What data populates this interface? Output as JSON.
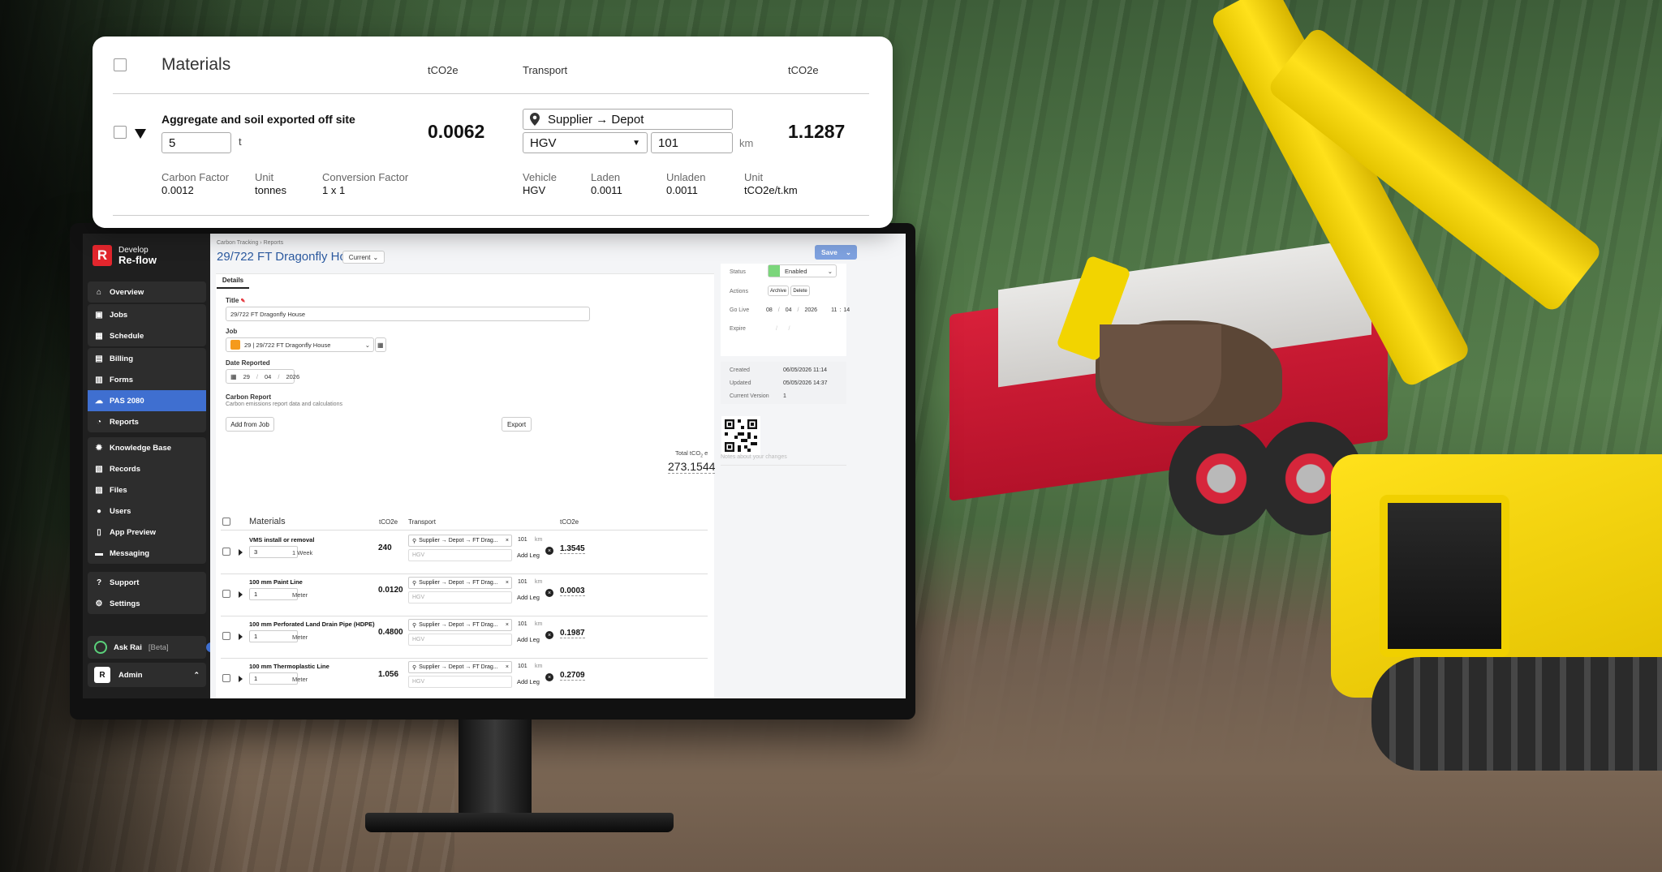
{
  "colors": {
    "brand": "#e3262d",
    "accent": "#2c5aa0",
    "active_nav": "#3f6fd0",
    "status": "#7bd67b"
  },
  "popup": {
    "header": {
      "materials": "Materials",
      "tco2e": "tCO2e",
      "transport": "Transport",
      "tco2e_2": "tCO2e"
    },
    "item": {
      "name": "Aggregate and soil exported off site",
      "qty": "5",
      "qty_unit": "t",
      "tco2e": "0.0062",
      "route": "Supplier → Depot",
      "vehicle_select": "HGV",
      "distance": "101",
      "distance_unit": "km",
      "transport_tco2e": "1.1287",
      "carbon_factor_label": "Carbon Factor",
      "carbon_factor": "0.0012",
      "unit_label": "Unit",
      "unit": "tonnes",
      "conversion_label": "Conversion Factor",
      "conversion": "1 x 1",
      "vehicle_label": "Vehicle",
      "vehicle": "HGV",
      "laden_label": "Laden",
      "laden": "0.0011",
      "unladen_label": "Unladen",
      "unladen": "0.0011",
      "tunit_label": "Unit",
      "tunit": "tCO2e/t.km"
    },
    "icons": {
      "route": "map-pin-icon",
      "expand": "caret-down-icon"
    }
  },
  "app": {
    "logo": {
      "mark": "R",
      "line1": "Develop",
      "line2": "Re-flow"
    },
    "nav": {
      "group1": [
        {
          "label": "Overview",
          "icon": "home-icon"
        }
      ],
      "group2": [
        {
          "label": "Jobs",
          "icon": "briefcase-icon"
        },
        {
          "label": "Schedule",
          "icon": "calendar-icon"
        }
      ],
      "group3": [
        {
          "label": "Billing",
          "icon": "billing-icon"
        },
        {
          "label": "Forms",
          "icon": "forms-icon"
        },
        {
          "label": "PAS 2080",
          "icon": "cloud-icon"
        },
        {
          "label": "Reports",
          "icon": "chart-icon"
        }
      ],
      "group4": [
        {
          "label": "Knowledge Base",
          "icon": "bulb-icon"
        },
        {
          "label": "Records",
          "icon": "records-icon"
        },
        {
          "label": "Files",
          "icon": "files-icon"
        },
        {
          "label": "Users",
          "icon": "users-icon"
        },
        {
          "label": "App Preview",
          "icon": "phone-icon"
        },
        {
          "label": "Messaging",
          "icon": "message-icon"
        }
      ],
      "group5": [
        {
          "label": "Support",
          "icon": "help-icon"
        },
        {
          "label": "Settings",
          "icon": "gear-icon"
        }
      ]
    },
    "ask_rai": {
      "label": "Ask Rai",
      "beta": "[Beta]"
    },
    "admin": {
      "initial": "R",
      "label": "Admin"
    },
    "breadcrumb": "Carbon Tracking  ›  Reports",
    "page_title": "29/722 FT Dragonfly House",
    "version": "Current",
    "save": "Save",
    "tab": "Details",
    "form": {
      "title_label": "Title",
      "title_value": "29/722 FT Dragonfly House",
      "job_label": "Job",
      "job_value": "29 | 29/722 FT Dragonfly House",
      "date_label": "Date Reported",
      "date_d": "29",
      "date_m": "04",
      "date_y": "2026",
      "report_label": "Carbon Report",
      "report_sub": "Carbon emissions report data and calculations",
      "add_from_job": "Add from Job",
      "export": "Export",
      "total_label": "Total tCO",
      "total_sub": "2",
      "total_suffix": "e",
      "total_value": "273.1544"
    },
    "table": {
      "headers": {
        "materials": "Materials",
        "tco2e": "tCO2e",
        "transport": "Transport",
        "tco2e_2": "tCO2e"
      },
      "rows": [
        {
          "name": "VMS install or removal",
          "qty": "3",
          "unit": "1 Week",
          "tco2e": "240",
          "route": "Supplier → Depot → FT Drag...",
          "vehicle": "HGV",
          "distance": "101",
          "km": "km",
          "add_leg": "Add Leg",
          "t_tco2e": "1.3545"
        },
        {
          "name": "100 mm Paint Line",
          "qty": "1",
          "unit": "Meter",
          "tco2e": "0.0120",
          "route": "Supplier → Depot → FT Drag...",
          "vehicle": "HGV",
          "distance": "101",
          "km": "km",
          "add_leg": "Add Leg",
          "t_tco2e": "0.0003"
        },
        {
          "name": "100 mm Perforated Land Drain Pipe (HDPE)",
          "qty": "1",
          "unit": "Meter",
          "tco2e": "0.4800",
          "route": "Supplier → Depot → FT Drag...",
          "vehicle": "HGV",
          "distance": "101",
          "km": "km",
          "add_leg": "Add Leg",
          "t_tco2e": "0.1987"
        },
        {
          "name": "100 mm Thermoplastic Line",
          "qty": "1",
          "unit": "Meter",
          "tco2e": "1.056",
          "route": "Supplier → Depot → FT Drag...",
          "vehicle": "HGV",
          "distance": "101",
          "km": "km",
          "add_leg": "Add Leg",
          "t_tco2e": "0.2709"
        }
      ]
    },
    "right": {
      "status_label": "Status",
      "status_value": "Enabled",
      "actions_label": "Actions",
      "archive": "Archive",
      "delete": "Delete",
      "golive_label": "Go Live",
      "golive_d": "08",
      "golive_m": "04",
      "golive_y": "2026",
      "golive_h": "11",
      "golive_min": "14",
      "expire_label": "Expire",
      "created_label": "Created",
      "created": "06/05/2026 11:14",
      "updated_label": "Updated",
      "updated": "05/05/2026 14:37",
      "version_label": "Current Version",
      "version": "1",
      "notes_placeholder": "Notes about your changes"
    }
  }
}
